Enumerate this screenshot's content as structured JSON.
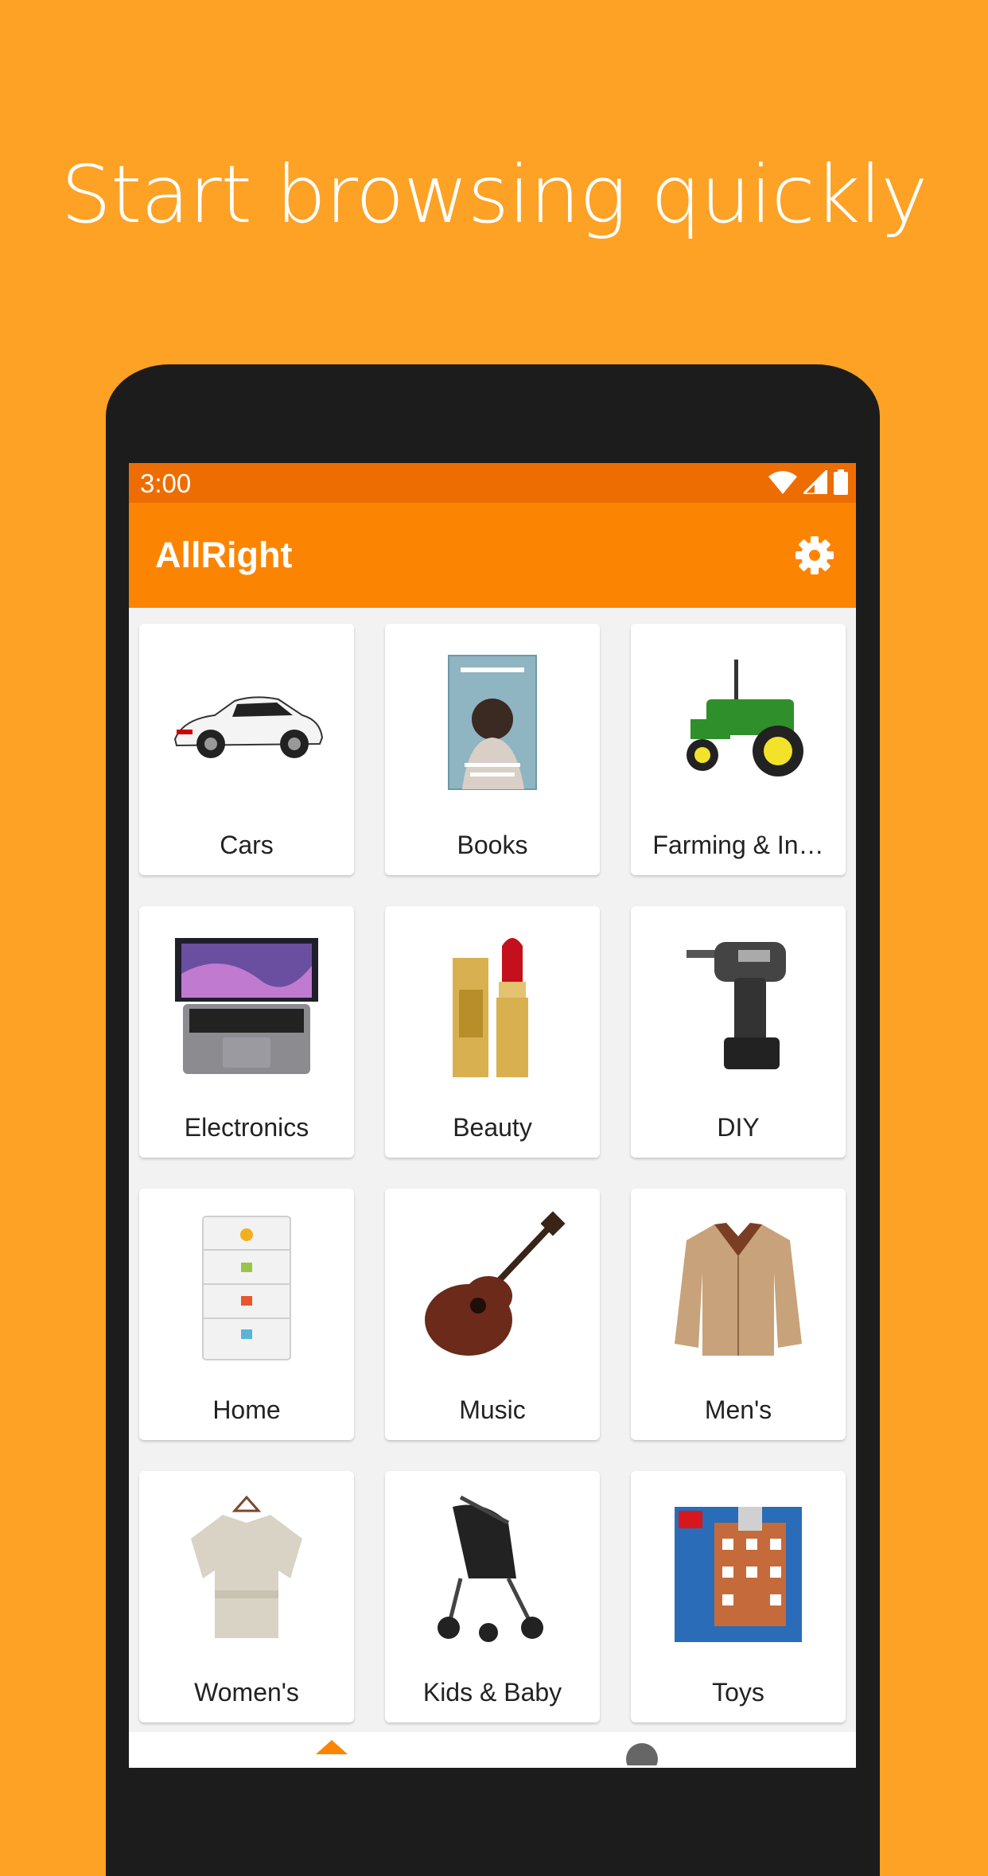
{
  "headline": "Start browsing quickly",
  "status_bar": {
    "time": "3:00"
  },
  "app_bar": {
    "title": "AllRight"
  },
  "categories": [
    {
      "label": "Cars",
      "icon": "car-icon"
    },
    {
      "label": "Books",
      "icon": "book-icon"
    },
    {
      "label": "Farming & In…",
      "icon": "tractor-icon"
    },
    {
      "label": "Electronics",
      "icon": "laptop-icon"
    },
    {
      "label": "Beauty",
      "icon": "lipstick-icon"
    },
    {
      "label": "DIY",
      "icon": "drill-icon"
    },
    {
      "label": "Home",
      "icon": "drawer-icon"
    },
    {
      "label": "Music",
      "icon": "guitar-icon"
    },
    {
      "label": "Men's",
      "icon": "jacket-icon"
    },
    {
      "label": "Women's",
      "icon": "blouse-icon"
    },
    {
      "label": "Kids & Baby",
      "icon": "stroller-icon"
    },
    {
      "label": "Toys",
      "icon": "lego-box-icon"
    }
  ],
  "colors": {
    "background": "#FDA225",
    "status_bar": "#EE6D02",
    "app_bar": "#FB8503",
    "phone_body": "#1C1C1C"
  }
}
